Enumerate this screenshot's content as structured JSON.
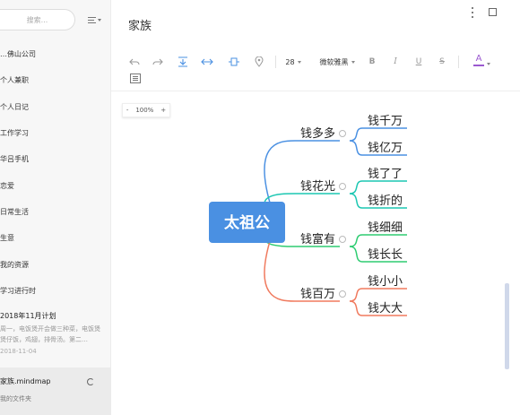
{
  "sidebar": {
    "search_placeholder": "搜索...",
    "notebooks": [
      "…佛山公司",
      "个人兼职",
      "个人日记",
      "工作学习",
      "华吕手机",
      "恋爱",
      "日常生活",
      "生意",
      "我的资源",
      "学习进行时"
    ],
    "note": {
      "title": "2018年11月计划",
      "excerpt": "周一，电饭煲开会做三种菜，电饭煲煲仔饭，鸡翅，排骨汤。第二…",
      "date": "2018-11-04"
    },
    "file": {
      "name": "家族.mindmap",
      "folder": "我的文件夹"
    }
  },
  "header": {
    "title": "家族"
  },
  "toolbar": {
    "font_size": "28",
    "font_name": "微软雅黑",
    "bold": "B",
    "italic": "I",
    "underline": "U",
    "strike": "S",
    "font_color": "A",
    "font_color_value": "#9b59d0"
  },
  "canvas": {
    "zoom_minus": "-",
    "zoom_level": "100%",
    "zoom_plus": "+"
  },
  "mindmap": {
    "root": "太祖公",
    "root_color": "#4a90e2",
    "branches": [
      {
        "label": "钱多多",
        "color": "#4a90e2",
        "children": [
          "钱千万",
          "钱亿万"
        ]
      },
      {
        "label": "钱花光",
        "color": "#1cc7b2",
        "children": [
          "钱了了",
          "钱折的"
        ]
      },
      {
        "label": "钱富有",
        "color": "#2ecc71",
        "children": [
          "钱细细",
          "钱长长"
        ]
      },
      {
        "label": "钱百万",
        "color": "#f07a5e",
        "children": [
          "钱小小",
          "钱大大"
        ]
      }
    ]
  }
}
